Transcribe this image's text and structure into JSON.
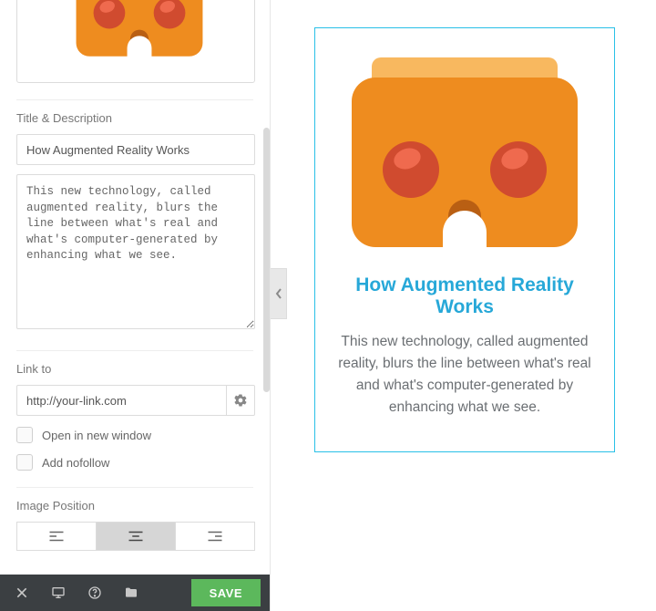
{
  "title_desc_label": "Title & Description",
  "title_value": "How Augmented Reality Works",
  "description_value": "This new technology, called augmented reality, blurs the line between what's real and what's computer-generated by enhancing what we see.",
  "link_to_label": "Link to",
  "link_value": "http://your-link.com",
  "open_new_window_label": "Open in new window",
  "add_nofollow_label": "Add nofollow",
  "image_position_label": "Image Position",
  "image_position_selected": "center",
  "footer": {
    "save_label": "SAVE"
  },
  "preview": {
    "title": "How Augmented Reality Works",
    "description": "This new technology, called augmented reality, blurs the line between what's real and what's computer-generated by enhancing what we see."
  },
  "colors": {
    "accent": "#29c0e7",
    "save": "#5cb85c",
    "vr_body": "#ee8c1f",
    "vr_strap": "#f8b85f",
    "vr_lens": "#d04b2f"
  }
}
